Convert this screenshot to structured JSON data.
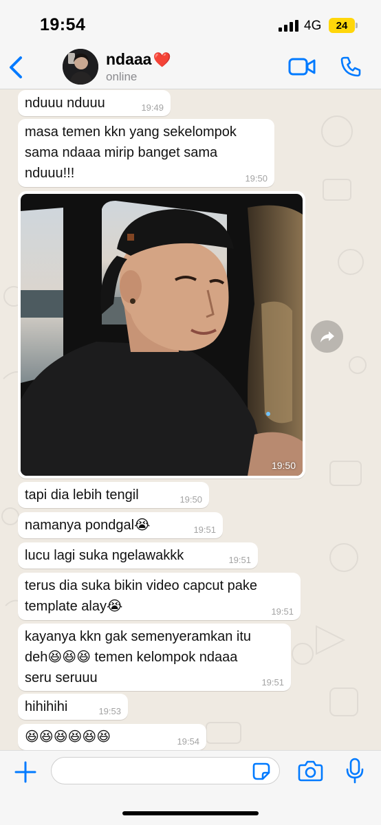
{
  "status_bar": {
    "time": "19:54",
    "network": "4G",
    "battery": "24"
  },
  "header": {
    "contact_name": "ndaaa",
    "name_emoji": "❤️",
    "status": "online",
    "accent_color": "#007aff"
  },
  "messages": [
    {
      "text": "nduuu nduuu",
      "time": "19:49"
    },
    {
      "text": "masa temen kkn yang sekelompok\nsama ndaaa mirip banget sama\nnduuu!!!",
      "time": "19:50"
    },
    {
      "image": "photo-of-young-man-in-cap-in-car",
      "time": "19:50"
    },
    {
      "text": "tapi dia lebih tengil",
      "time": "19:50"
    },
    {
      "text": "namanya pondgal😭",
      "time": "19:51"
    },
    {
      "text": "lucu lagi suka ngelawakkk",
      "time": "19:51"
    },
    {
      "text": "terus dia suka bikin video capcut pake\ntemplate alay😭",
      "time": "19:51"
    },
    {
      "text": "kayanya kkn gak semenyeramkan itu\ndeh😆😆😆 temen kelompok ndaaa\nseru seruuu",
      "time": "19:51"
    },
    {
      "text": "hihihihi",
      "time": "19:53"
    },
    {
      "text": "😆😆😆😆😆😆",
      "time": "19:54"
    }
  ],
  "input_bar": {
    "placeholder": "",
    "value": ""
  },
  "icons": {
    "back": "chevron-left-icon",
    "video": "video-camera-icon",
    "call": "phone-icon",
    "forward": "forward-arrow-icon",
    "plus": "plus-icon",
    "sticker": "sticker-icon",
    "camera": "camera-icon",
    "mic": "microphone-icon"
  },
  "colors": {
    "chat_background": "#efeae2",
    "bubble": "#ffffff",
    "battery": "#ffd60a"
  }
}
